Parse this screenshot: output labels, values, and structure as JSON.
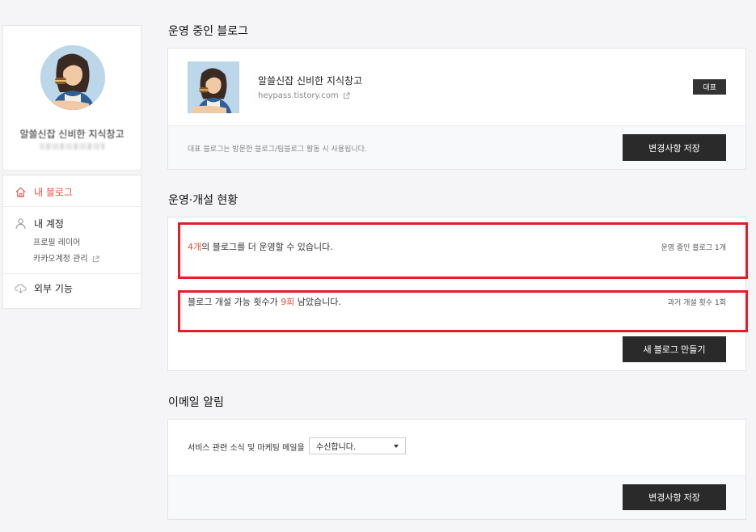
{
  "profile": {
    "name": "알쓸신잡 신비한 지식창고"
  },
  "sidebar": {
    "my_blog": "내 블로그",
    "my_account": "내 계정",
    "profile_layer": "프로필 레이어",
    "kakao_account": "카카오계정 관리",
    "external": "외부 기능"
  },
  "running": {
    "title": "운영 중인 블로그",
    "blog_name": "알쓸신잡 신비한 지식창고",
    "blog_url": "heypass.tistory.com",
    "badge": "대표",
    "note": "대표 블로그는 방문한 블로그/팀블로그 활동 시 사용됩니다.",
    "save_label": "변경사항 저장"
  },
  "status": {
    "title": "운영·개설 현황",
    "line1_count": "4개",
    "line1_rest": "의 블로그를 더 운영할 수 있습니다.",
    "line1_right": "운영 중인 블로그 1개",
    "line2_pre": "블로그 개설 가능 횟수가 ",
    "line2_count": "9회",
    "line2_post": " 남았습니다.",
    "line2_right": "과거 개설 횟수 1회",
    "new_blog_label": "새 블로그 만들기"
  },
  "email": {
    "title": "이메일 알림",
    "label": "서비스 관련 소식 및 마케팅 메일을",
    "selected": "수신합니다.",
    "save_label": "변경사항 저장"
  },
  "colors": {
    "accent": "#e0533d",
    "highlight_box": "#e01f26",
    "button": "#2a2a2a"
  }
}
